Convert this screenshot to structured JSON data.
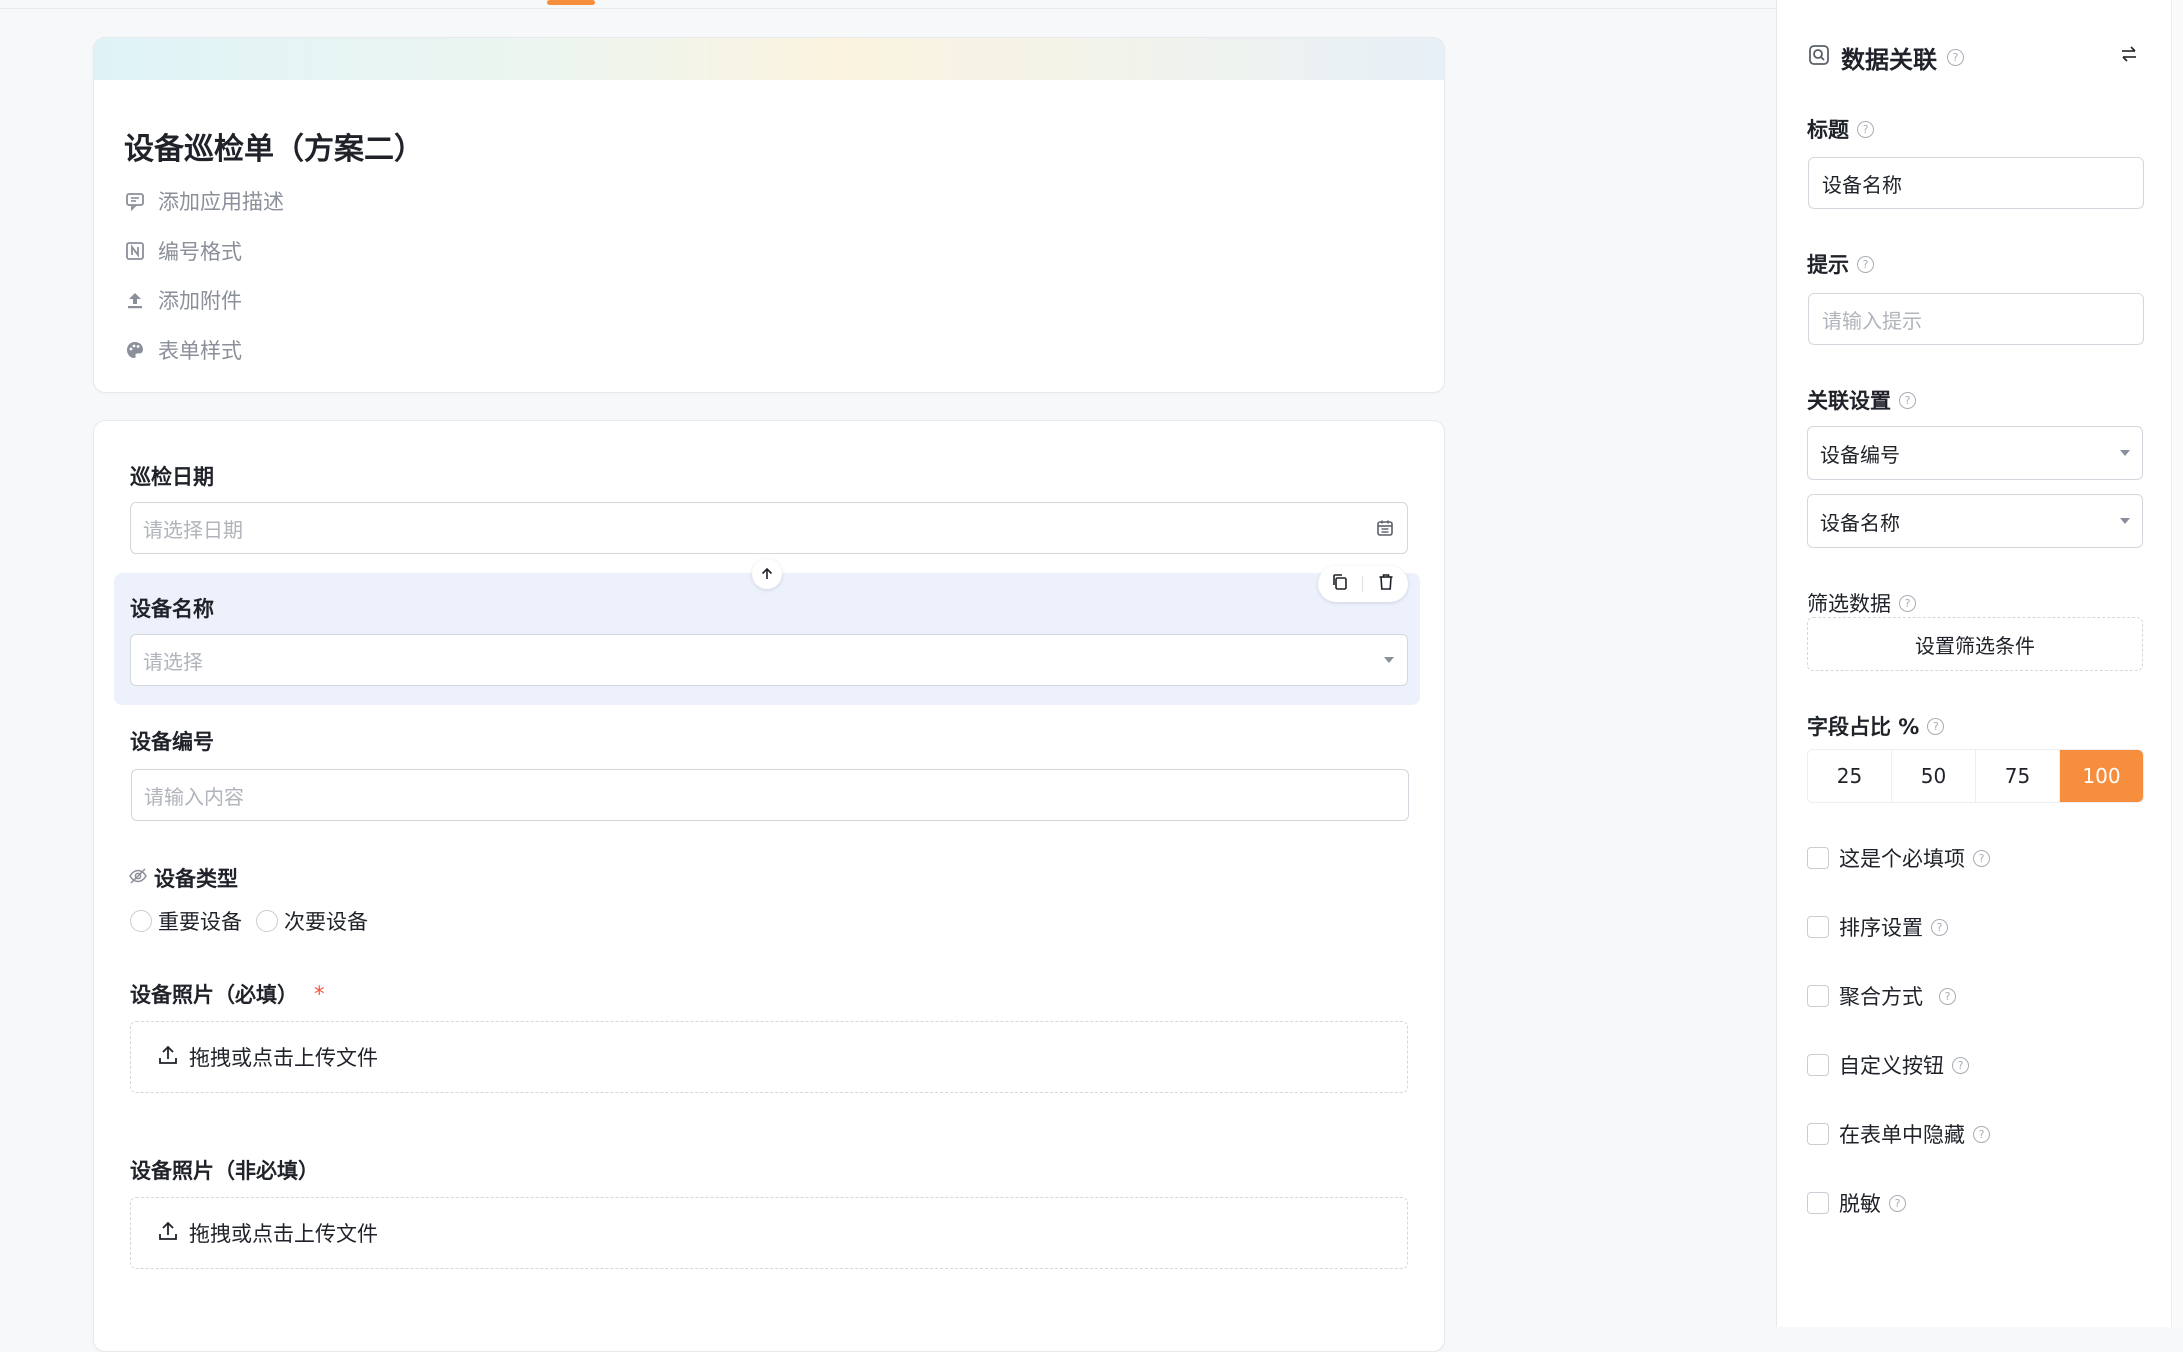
{
  "canvas": {
    "title": "设备巡检单（方案二）",
    "meta": [
      {
        "label": "添加应用描述",
        "icon": "comment-icon"
      },
      {
        "label": "编号格式",
        "icon": "numbering-icon"
      },
      {
        "label": "添加附件",
        "icon": "upload-icon"
      },
      {
        "label": "表单样式",
        "icon": "palette-icon"
      }
    ],
    "fields": {
      "date": {
        "label": "巡检日期",
        "placeholder": "请选择日期"
      },
      "device_name": {
        "label": "设备名称",
        "placeholder": "请选择"
      },
      "device_no": {
        "label": "设备编号",
        "placeholder": "请输入内容"
      },
      "device_type": {
        "label": "设备类型",
        "options": [
          "重要设备",
          "次要设备"
        ]
      },
      "photo_required": {
        "label": "设备照片（必填）",
        "required_mark": "*",
        "upload_text": "拖拽或点击上传文件"
      },
      "photo_optional": {
        "label": "设备照片（非必填）",
        "upload_text": "拖拽或点击上传文件"
      }
    }
  },
  "panel": {
    "title": "数据关联",
    "title_label": "标题",
    "title_value": "设备名称",
    "hint_label": "提示",
    "hint_placeholder": "请输入提示",
    "assoc_label": "关联设置",
    "assoc_select_1": "设备编号",
    "assoc_select_2": "设备名称",
    "filter_label": "筛选数据",
    "filter_button": "设置筛选条件",
    "ratio_label": "字段占比 %",
    "ratio_options": [
      "25",
      "50",
      "75",
      "100"
    ],
    "ratio_selected": "100",
    "checks": [
      "这是个必填项",
      "排序设置",
      "聚合方式",
      "自定义按钮",
      "在表单中隐藏",
      "脱敏"
    ]
  },
  "colors": {
    "accent": "#f78e3d",
    "selected_bg": "#edf1fc",
    "required": "#f5503d"
  }
}
